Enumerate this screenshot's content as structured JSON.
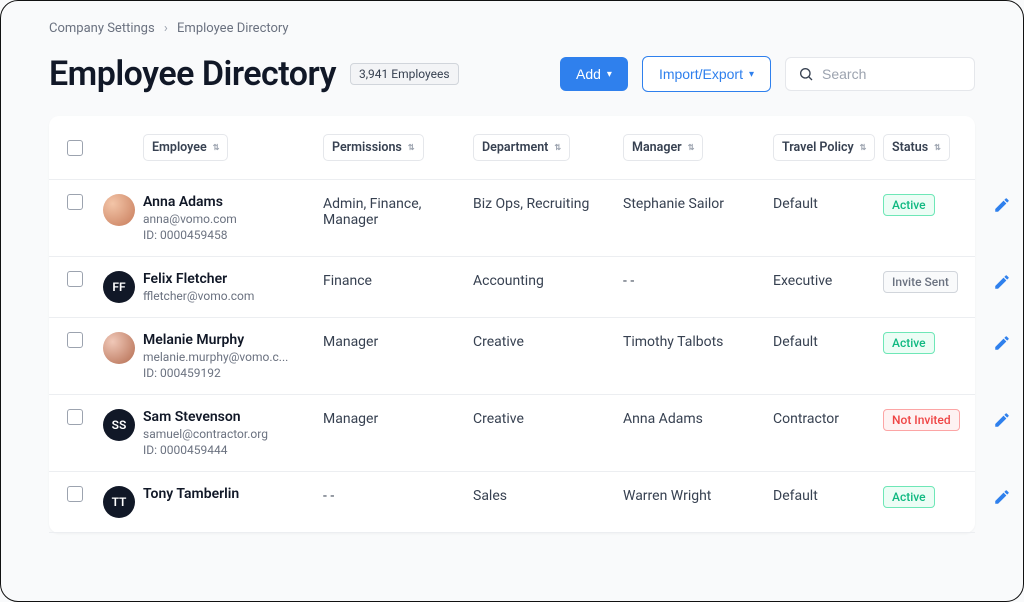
{
  "breadcrumb": {
    "parent": "Company Settings",
    "current": "Employee Directory"
  },
  "title": "Employee Directory",
  "count_badge": "3,941 Employees",
  "actions": {
    "add": "Add",
    "import_export": "Import/Export"
  },
  "search": {
    "placeholder": "Search"
  },
  "columns": {
    "employee": "Employee",
    "permissions": "Permissions",
    "department": "Department",
    "manager": "Manager",
    "travel_policy": "Travel Policy",
    "status": "Status"
  },
  "rows": [
    {
      "avatar_type": "photo1",
      "initials": "",
      "name": "Anna Adams",
      "email": "anna@vomo.com",
      "id_line": "ID: 0000459458",
      "permissions": "Admin, Finance, Manager",
      "department": "Biz Ops, Recruiting",
      "manager": "Stephanie Sailor",
      "travel_policy": "Default",
      "status_label": "Active",
      "status_class": "status-active"
    },
    {
      "avatar_type": "dark",
      "initials": "FF",
      "name": "Felix Fletcher",
      "email": "ffletcher@vomo.com",
      "id_line": "",
      "permissions": "Finance",
      "department": "Accounting",
      "manager": "- -",
      "travel_policy": "Executive",
      "status_label": "Invite Sent",
      "status_class": "status-invite"
    },
    {
      "avatar_type": "photo2",
      "initials": "",
      "name": "Melanie Murphy",
      "email": "melanie.murphy@vomo.c...",
      "id_line": "ID: 000459192",
      "permissions": "Manager",
      "department": "Creative",
      "manager": "Timothy Talbots",
      "travel_policy": "Default",
      "status_label": "Active",
      "status_class": "status-active"
    },
    {
      "avatar_type": "dark",
      "initials": "SS",
      "name": "Sam Stevenson",
      "email": "samuel@contractor.org",
      "id_line": "ID: 0000459444",
      "permissions": "Manager",
      "department": "Creative",
      "manager": "Anna Adams",
      "travel_policy": "Contractor",
      "status_label": "Not Invited",
      "status_class": "status-not"
    },
    {
      "avatar_type": "dark",
      "initials": "TT",
      "name": "Tony Tamberlin",
      "email": "",
      "id_line": "",
      "permissions": "- -",
      "department": "Sales",
      "manager": "Warren Wright",
      "travel_policy": "Default",
      "status_label": "Active",
      "status_class": "status-active"
    }
  ]
}
